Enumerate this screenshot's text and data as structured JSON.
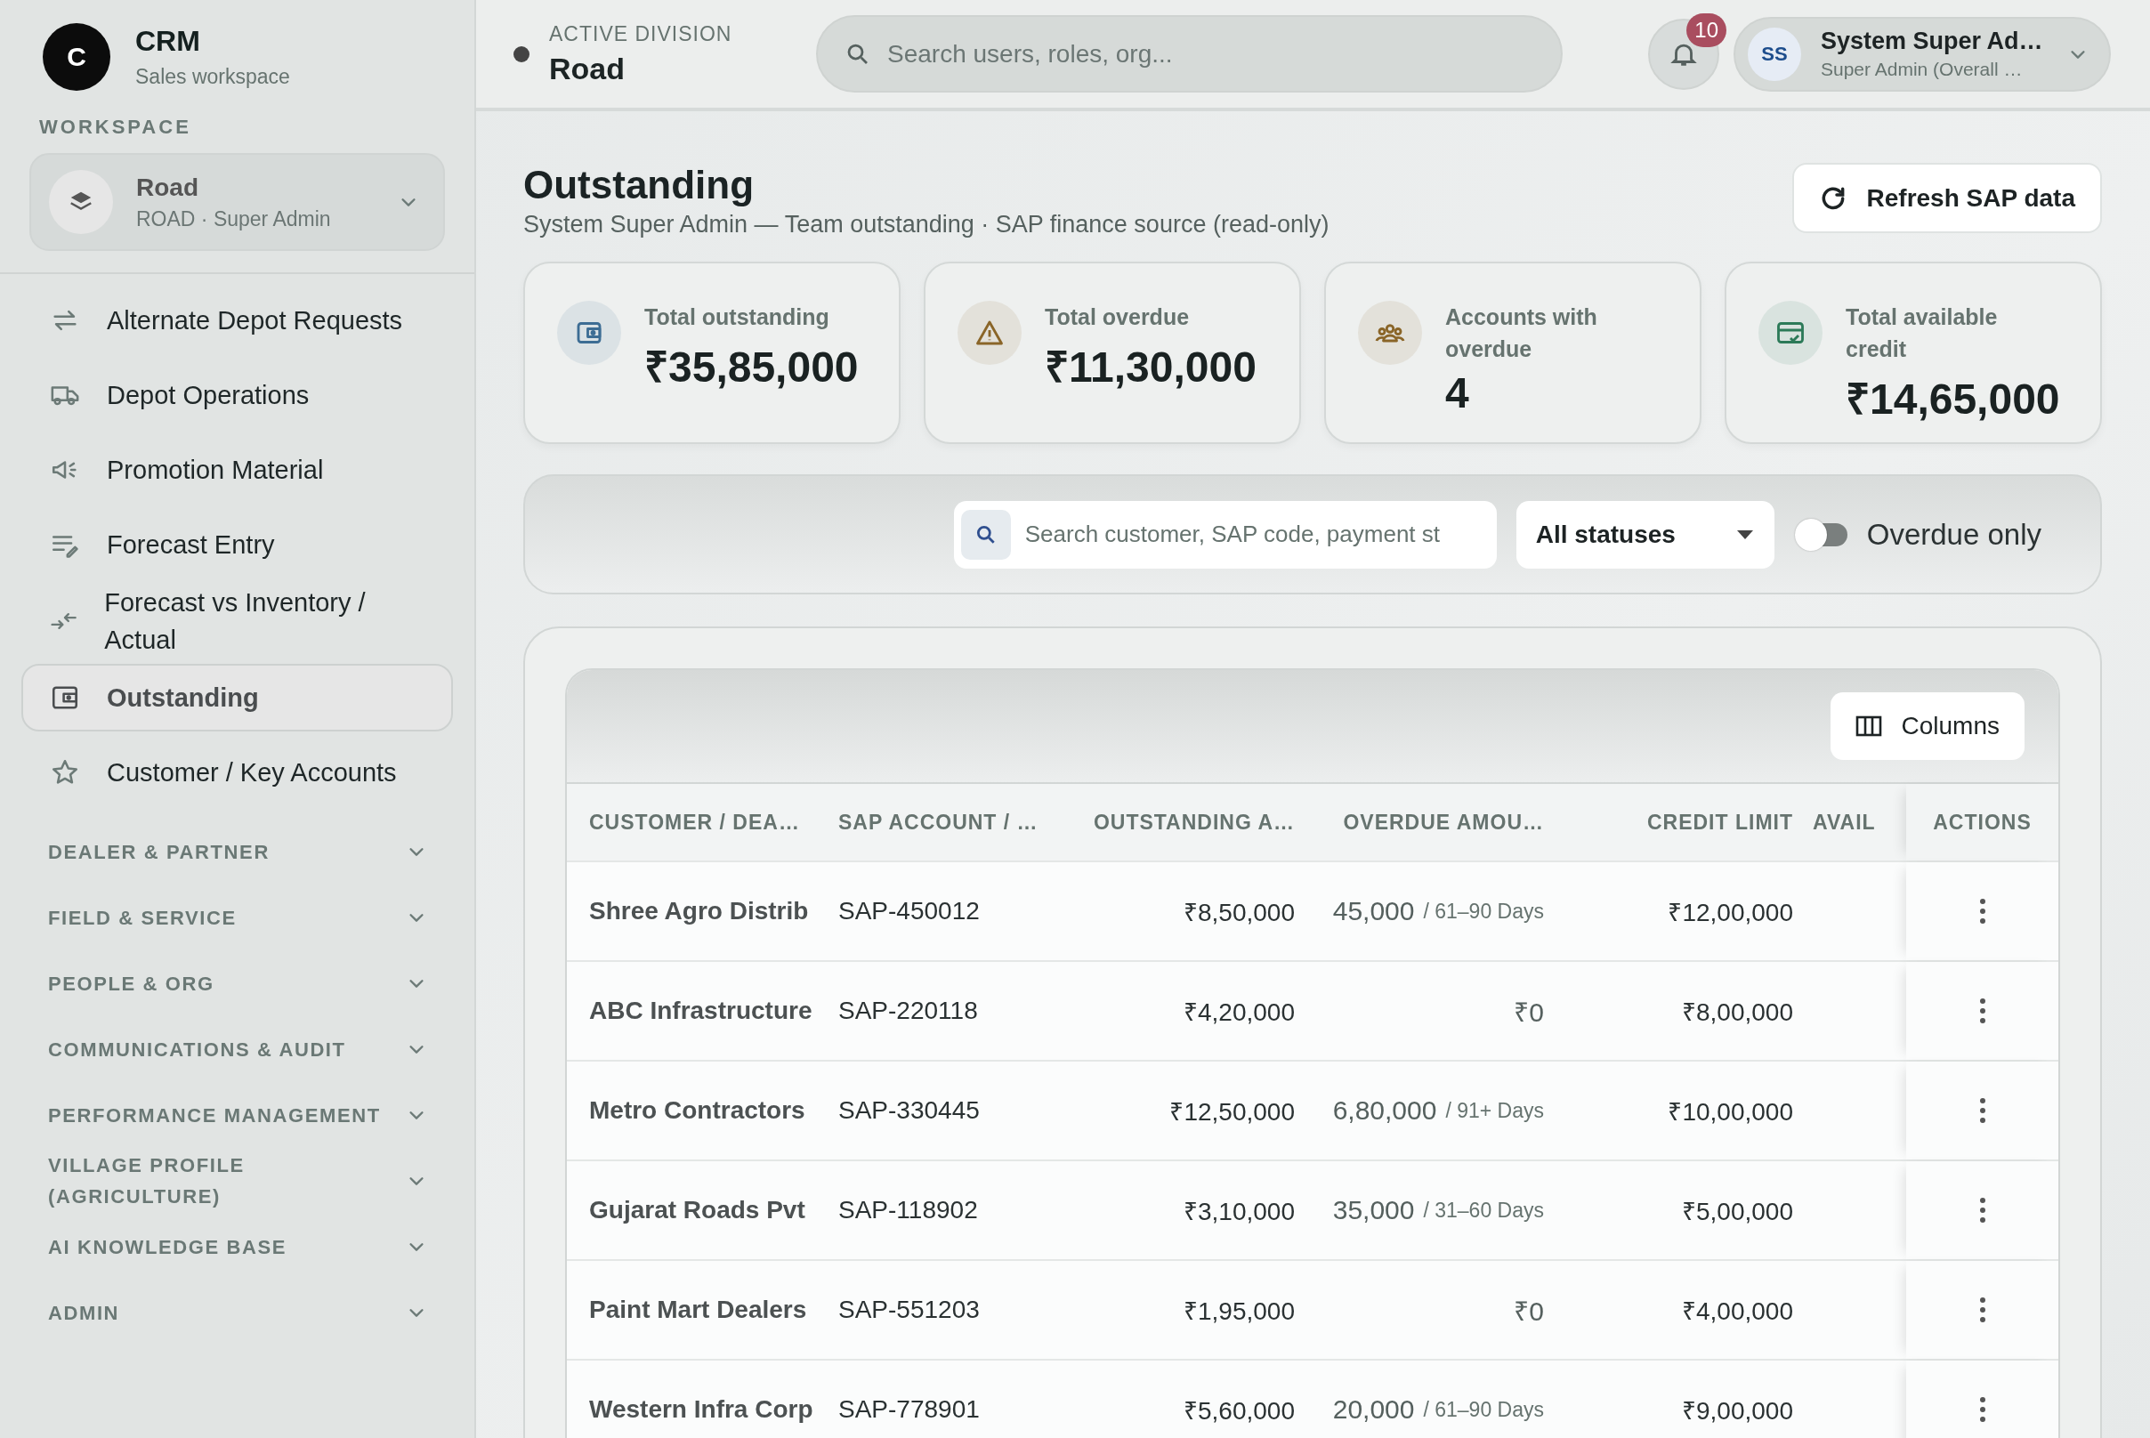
{
  "brand": {
    "logo_letter": "C",
    "name": "CRM",
    "subtitle": "Sales workspace"
  },
  "workspace": {
    "heading": "WORKSPACE",
    "name": "Road",
    "detail": "ROAD · Super Admin"
  },
  "sidebar": {
    "items": [
      {
        "kind": "link",
        "label": "Alternate Depot Requests",
        "selected": false
      },
      {
        "kind": "link",
        "label": "Depot Operations",
        "selected": false
      },
      {
        "kind": "link",
        "label": "Promotion Material",
        "selected": false
      },
      {
        "kind": "link",
        "label": "Forecast Entry",
        "selected": false
      },
      {
        "kind": "link",
        "label": "Forecast vs Inventory / Actual",
        "selected": false
      },
      {
        "kind": "link",
        "label": "Outstanding",
        "selected": true
      },
      {
        "kind": "link",
        "label": "Customer / Key Accounts",
        "selected": false
      },
      {
        "kind": "section",
        "label": "DEALER & PARTNER",
        "expanded": false
      },
      {
        "kind": "section",
        "label": "FIELD & SERVICE",
        "expanded": false
      },
      {
        "kind": "section",
        "label": "PEOPLE & ORG",
        "expanded": false
      },
      {
        "kind": "section",
        "label": "COMMUNICATIONS & AUDIT",
        "expanded": false
      },
      {
        "kind": "section",
        "label": "PERFORMANCE MANAGEMENT",
        "expanded": false
      },
      {
        "kind": "section",
        "label": "VILLAGE PROFILE (AGRICULTURE)",
        "expanded": false
      },
      {
        "kind": "section",
        "label": "AI KNOWLEDGE BASE",
        "expanded": false
      },
      {
        "kind": "section",
        "label": "ADMIN",
        "expanded": false
      }
    ]
  },
  "header": {
    "division_label": "ACTIVE DIVISION",
    "division": "Road",
    "search_placeholder": "Search users, roles, org...",
    "notifications": "10",
    "user": {
      "initials": "SS",
      "name": "System Super Ad…",
      "role": "Super Admin (Overall …"
    }
  },
  "page": {
    "title": "Outstanding",
    "subtitle": "System Super Admin — Team outstanding · SAP finance source (read-only)",
    "refresh_button": "Refresh SAP data"
  },
  "kpis": [
    {
      "label": "Total outstanding",
      "value": "₹35,85,000",
      "color": "#3d6d94"
    },
    {
      "label": "Total overdue",
      "value": "₹11,30,000",
      "color": "#8a6528"
    },
    {
      "label": "Accounts with overdue",
      "value": "4",
      "color": "#8a6528"
    },
    {
      "label": "Total available credit",
      "value": "₹14,65,000",
      "color": "#2c7a58"
    }
  ],
  "filters": {
    "search_placeholder": "Search customer, SAP code, payment st",
    "status": "All statuses",
    "overdue_only": {
      "label": "Overdue only",
      "on": false
    }
  },
  "table": {
    "columns_button": "Columns",
    "columns": [
      "CUSTOMER / DEA…",
      "SAP ACCOUNT / …",
      "OUTSTANDING A…",
      "OVERDUE AMOU…",
      "CREDIT LIMIT",
      "AVAIL",
      "ACTIONS"
    ],
    "rows": [
      {
        "customer": "Shree Agro Distrib",
        "sap": "SAP-450012",
        "outstanding": "₹8,50,000",
        "overdue": "45,000",
        "bucket": "/ 61–90 Days",
        "credit_limit": "₹12,00,000"
      },
      {
        "customer": "ABC Infrastructure",
        "sap": "SAP-220118",
        "outstanding": "₹4,20,000",
        "overdue": "₹0",
        "credit_limit": "₹8,00,000"
      },
      {
        "customer": "Metro Contractors",
        "sap": "SAP-330445",
        "outstanding": "₹12,50,000",
        "overdue": "6,80,000",
        "bucket": "/ 91+ Days",
        "credit_limit": "₹10,00,000"
      },
      {
        "customer": "Gujarat Roads Pvt",
        "sap": "SAP-118902",
        "outstanding": "₹3,10,000",
        "overdue": "35,000",
        "bucket": "/ 31–60 Days",
        "credit_limit": "₹5,00,000"
      },
      {
        "customer": "Paint Mart Dealers",
        "sap": "SAP-551203",
        "outstanding": "₹1,95,000",
        "overdue": "₹0",
        "credit_limit": "₹4,00,000"
      },
      {
        "customer": "Western Infra Corp",
        "sap": "SAP-778901",
        "outstanding": "₹5,60,000",
        "overdue": "20,000",
        "bucket": "/ 61–90 Days",
        "credit_limit": "₹9,00,000"
      }
    ]
  }
}
